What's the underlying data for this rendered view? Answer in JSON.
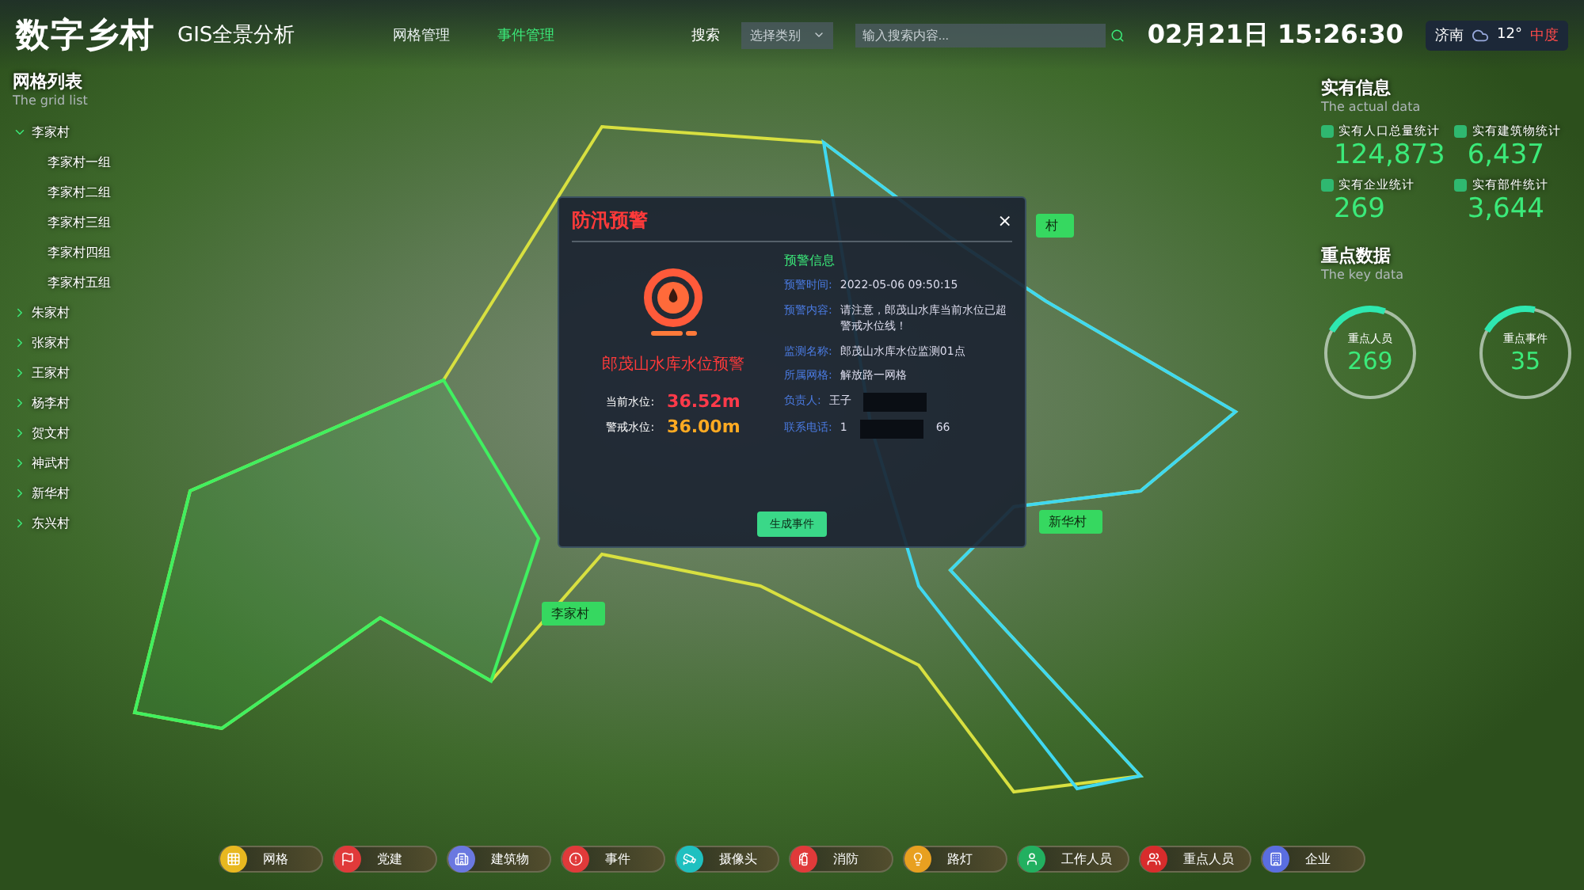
{
  "header": {
    "title": "数字乡村",
    "subtitle": "GIS全景分析",
    "nav": [
      {
        "label": "网格管理",
        "selected": false
      },
      {
        "label": "事件管理",
        "selected": true
      }
    ],
    "search": {
      "label": "搜索",
      "select": "选择类别",
      "placeholder": "输入搜索内容..."
    },
    "datetime": "02月21日 15:26:30",
    "weather": {
      "city": "济南",
      "temperature": "12°",
      "air_quality": "中度"
    }
  },
  "grid_list": {
    "title": "网格列表",
    "subtitle": "The grid list",
    "items": [
      {
        "label": "李家村",
        "expanded": true,
        "children": [
          {
            "label": "李家村一组"
          },
          {
            "label": "李家村二组"
          },
          {
            "label": "李家村三组"
          },
          {
            "label": "李家村四组"
          },
          {
            "label": "李家村五组"
          }
        ]
      },
      {
        "label": "朱家村",
        "expanded": false
      },
      {
        "label": "张家村",
        "expanded": false
      },
      {
        "label": "王家村",
        "expanded": false
      },
      {
        "label": "杨李村",
        "expanded": false
      },
      {
        "label": "贺文村",
        "expanded": false
      },
      {
        "label": "神武村",
        "expanded": false
      },
      {
        "label": "新华村",
        "expanded": false
      },
      {
        "label": "东兴村",
        "expanded": false
      }
    ]
  },
  "map_labels": [
    {
      "label": "李家村"
    },
    {
      "label": "新华村"
    },
    {
      "label": "村"
    }
  ],
  "popup": {
    "title": "防汛预警",
    "close": "×",
    "alert_name": "郎茂山水库水位预警",
    "levels": [
      {
        "label": "当前水位:",
        "value": "36.52m",
        "kind": "current"
      },
      {
        "label": "警戒水位:",
        "value": "36.00m",
        "kind": "warning"
      }
    ],
    "info_title": "预警信息",
    "info": [
      {
        "label": "预警时间:",
        "value": "2022-05-06  09:50:15"
      },
      {
        "label": "预警内容:",
        "value": "请注意，郎茂山水库当前水位已超警戒水位线！"
      },
      {
        "label": "监测名称:",
        "value": "郎茂山水库水位监测01点"
      },
      {
        "label": "所属网格:",
        "value": "解放路一网格"
      },
      {
        "label": "负责人:",
        "value": "王子",
        "redacted": true
      },
      {
        "label": "联系电话:",
        "value": "1",
        "redacted": true,
        "value_after": "66"
      }
    ],
    "button": "生成事件"
  },
  "actual_info": {
    "title": "实有信息",
    "subtitle": "The actual data",
    "stats": [
      {
        "label": "实有人口总量统计",
        "value": "124,873"
      },
      {
        "label": "实有建筑物统计",
        "value": "6,437"
      },
      {
        "label": "实有企业统计",
        "value": "269"
      },
      {
        "label": "实有部件统计",
        "value": "3,644"
      }
    ]
  },
  "key_data": {
    "title": "重点数据",
    "subtitle": "The key data",
    "rings": [
      {
        "label": "重点人员",
        "value": "269",
        "level": 0.22
      },
      {
        "label": "重点事件",
        "value": "35",
        "level": 0.2
      }
    ]
  },
  "layers": [
    {
      "label": "网格",
      "color": "#e8b820"
    },
    {
      "label": "党建",
      "color": "#e03a3a"
    },
    {
      "label": "建筑物",
      "color": "#6a78e0"
    },
    {
      "label": "事件",
      "color": "#e03a3a"
    },
    {
      "label": "摄像头",
      "color": "#1fc0c0"
    },
    {
      "label": "消防",
      "color": "#e03a3a"
    },
    {
      "label": "路灯",
      "color": "#e8a020"
    },
    {
      "label": "工作人员",
      "color": "#22b060"
    },
    {
      "label": "重点人员",
      "color": "#d82c2c"
    },
    {
      "label": "企业",
      "color": "#5a6ee0"
    }
  ]
}
